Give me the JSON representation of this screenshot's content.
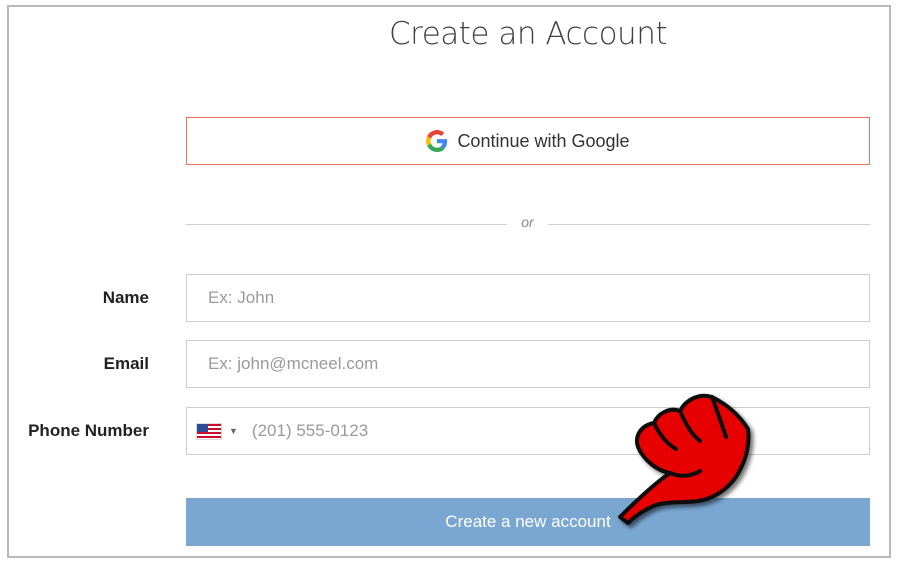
{
  "form": {
    "title": "Create an Account",
    "google_button_label": "Continue with Google",
    "divider_text": "or",
    "fields": {
      "name": {
        "label": "Name",
        "placeholder": "Ex: John"
      },
      "email": {
        "label": "Email",
        "placeholder": "Ex: john@mcneel.com"
      },
      "phone": {
        "label": "Phone Number",
        "placeholder": "(201) 555-0123",
        "country_flag": "us-flag-icon"
      }
    },
    "submit_label": "Create a new account"
  },
  "colors": {
    "google_border": "#e8735f",
    "submit_bg": "#7aa7d2",
    "pointer_red": "#e60000"
  },
  "icons": [
    "google-g-icon",
    "us-flag-icon",
    "caret-down-icon",
    "red-pointing-hand-icon"
  ]
}
